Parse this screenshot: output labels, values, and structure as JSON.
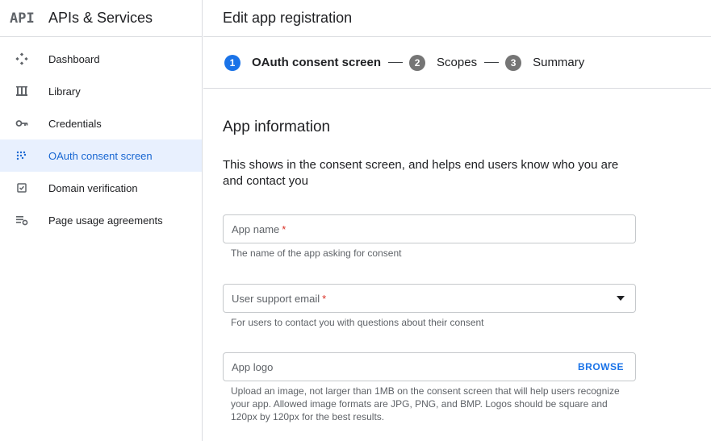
{
  "sidebar": {
    "logo": "API",
    "title": "APIs & Services",
    "items": [
      {
        "label": "Dashboard",
        "icon": "dashboard-icon"
      },
      {
        "label": "Library",
        "icon": "library-icon"
      },
      {
        "label": "Credentials",
        "icon": "key-icon"
      },
      {
        "label": "OAuth consent screen",
        "icon": "consent-icon",
        "active": true
      },
      {
        "label": "Domain verification",
        "icon": "checkbox-icon"
      },
      {
        "label": "Page usage agreements",
        "icon": "settings-list-icon"
      }
    ]
  },
  "header": {
    "title": "Edit app registration"
  },
  "stepper": {
    "steps": [
      {
        "num": "1",
        "label": "OAuth consent screen",
        "active": true
      },
      {
        "num": "2",
        "label": "Scopes"
      },
      {
        "num": "3",
        "label": "Summary"
      }
    ]
  },
  "section": {
    "title": "App information",
    "description": "This shows in the consent screen, and helps end users know who you are and contact you"
  },
  "fields": {
    "app_name": {
      "placeholder": "App name",
      "required": "*",
      "hint": "The name of the app asking for consent"
    },
    "support_email": {
      "placeholder": "User support email",
      "required": "*",
      "hint": "For users to contact you with questions about their consent"
    },
    "app_logo": {
      "placeholder": "App logo",
      "action": "BROWSE",
      "hint": "Upload an image, not larger than 1MB on the consent screen that will help users recognize your app. Allowed image formats are JPG, PNG, and BMP. Logos should be square and 120px by 120px for the best results."
    }
  },
  "colors": {
    "accent": "#1a73e8",
    "active_bg": "#e8f0fe",
    "required": "#d93025"
  }
}
